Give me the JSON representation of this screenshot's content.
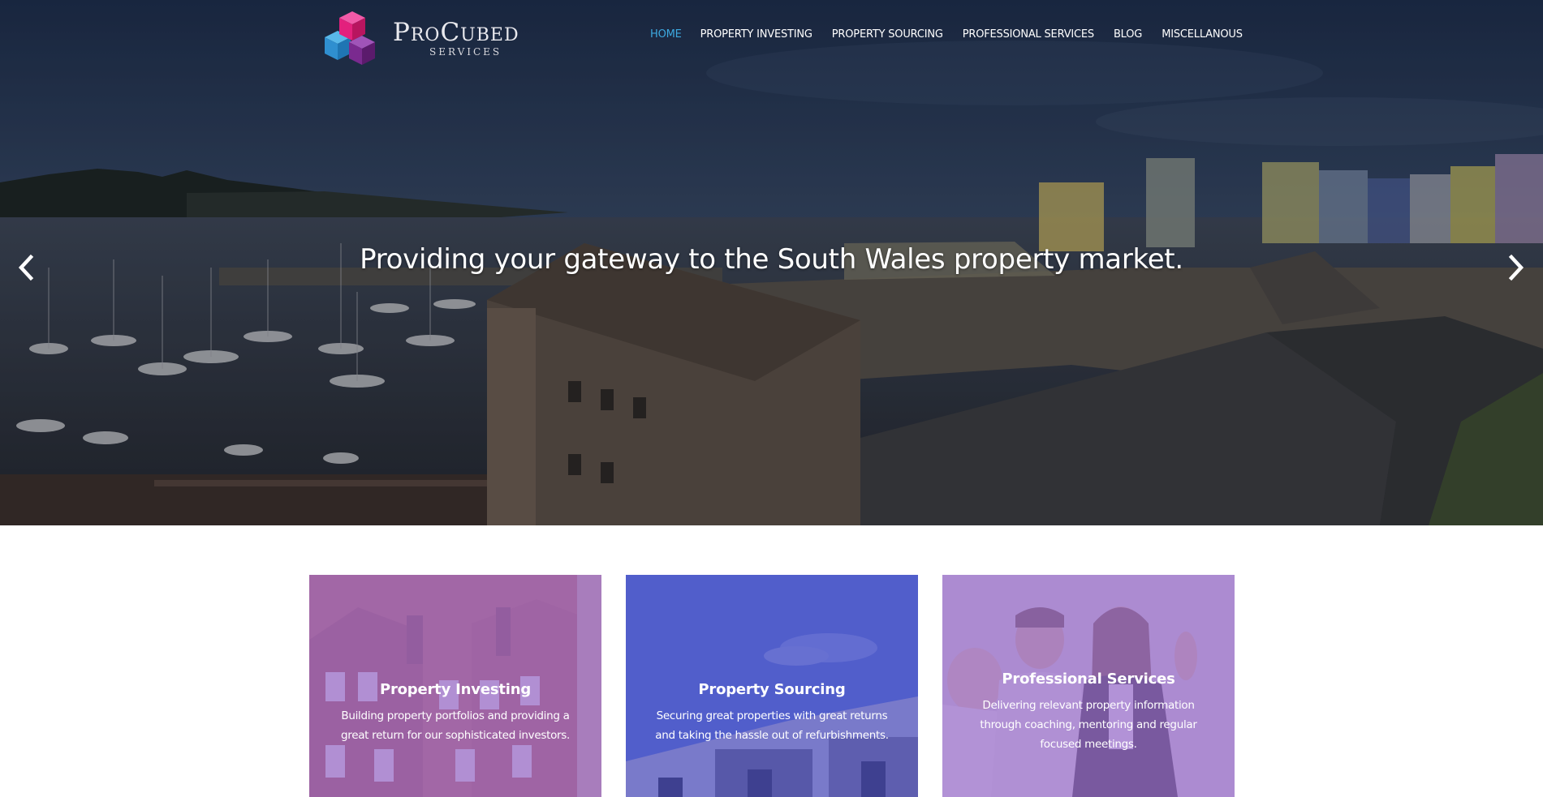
{
  "header": {
    "logo_brand": "ProCubed",
    "logo_sub": "SERVICES",
    "nav": [
      {
        "label": "HOME",
        "active": true
      },
      {
        "label": "PROPERTY INVESTING",
        "active": false
      },
      {
        "label": "PROPERTY SOURCING",
        "active": false
      },
      {
        "label": "PROFESSIONAL SERVICES",
        "active": false
      },
      {
        "label": "BLOG",
        "active": false
      },
      {
        "label": "MISCELLANOUS",
        "active": false
      }
    ]
  },
  "hero": {
    "headline": "Providing your gateway to the South Wales property market.",
    "prev_icon": "chevron-left-icon",
    "next_icon": "chevron-right-icon"
  },
  "cards": [
    {
      "title": "Property Investing",
      "text": "Building property portfolios and providing a great return for our sophisticated investors.",
      "overlay_color": "#9b6fd0"
    },
    {
      "title": "Property Sourcing",
      "text": "Securing great properties with great returns and taking the hassle out of refurbishments.",
      "overlay_color": "#4d54c4"
    },
    {
      "title": "Professional Services",
      "text": "Delivering relevant property information through coaching, mentoring and regular focused meetings.",
      "overlay_color": "#9a6fcc"
    }
  ],
  "colors": {
    "nav_active": "#3da9e0",
    "logo_pink": "#e3207d",
    "logo_blue": "#2f9de0",
    "logo_purple": "#7a2a8f"
  }
}
